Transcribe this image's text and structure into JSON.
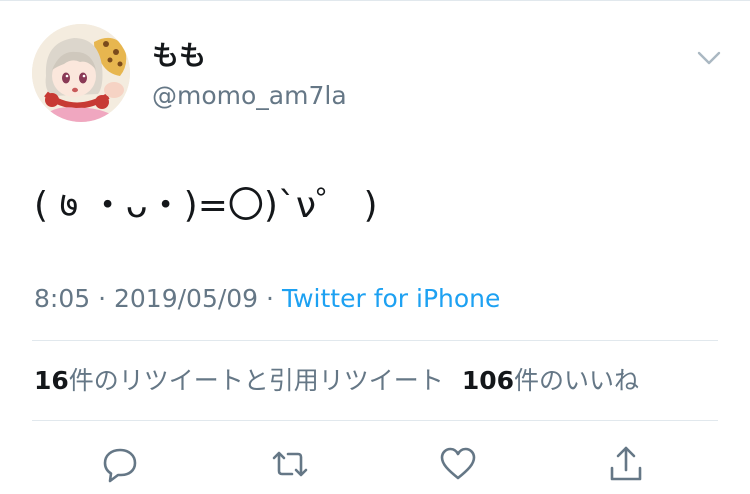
{
  "author": {
    "display_name": "もも",
    "handle": "@momo_am7la",
    "avatar_icon": "anime-avatar"
  },
  "tweet": {
    "text": "( ७ ・ᴗ・)=〇)`ν゜ )",
    "time": "8:05",
    "separator": "·",
    "date": "2019/05/09",
    "source": "Twitter for iPhone"
  },
  "stats": {
    "retweet_count": "16",
    "retweet_label": "件のリツイートと引用リツイート",
    "like_count": "106",
    "like_label": "件のいいね"
  },
  "icons": {
    "caret": "chevron-down-icon",
    "reply": "reply-icon",
    "retweet": "retweet-icon",
    "like": "heart-icon",
    "share": "share-icon"
  },
  "colors": {
    "text": "#14171a",
    "secondary": "#657786",
    "link": "#1da1f2",
    "divider": "#e1e8ed"
  }
}
